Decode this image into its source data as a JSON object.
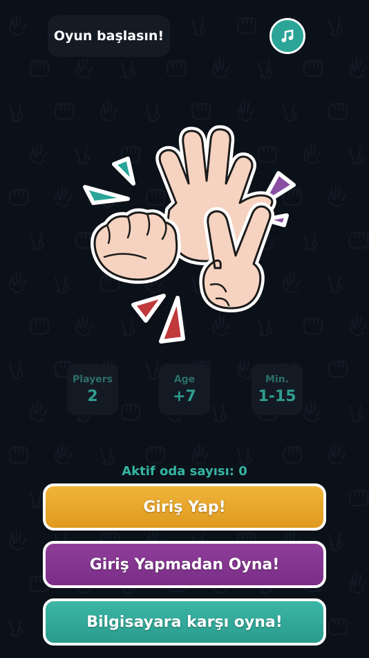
{
  "header": {
    "status_text": "Oyun başlasın!"
  },
  "music_button": {
    "icon": "music-note-icon"
  },
  "stats": [
    {
      "label": "Players",
      "value": "2"
    },
    {
      "label": "Age",
      "value": "+7"
    },
    {
      "label": "Min.",
      "value": "1-15"
    }
  ],
  "rooms": {
    "active_text": "Aktif oda sayısı: 0"
  },
  "buttons": {
    "login": "Giriş Yap!",
    "guest": "Giriş Yapmadan Oyna!",
    "computer": "Bilgisayara karşı oyna!"
  },
  "colors": {
    "background": "#0b1119",
    "accent_teal": "#2aa597",
    "login_orange": "#e9a92c",
    "guest_purple": "#852f8f",
    "cpu_teal": "#34ad9c",
    "triangle_red": "#c0393b",
    "triangle_purple": "#8a4fa3"
  }
}
